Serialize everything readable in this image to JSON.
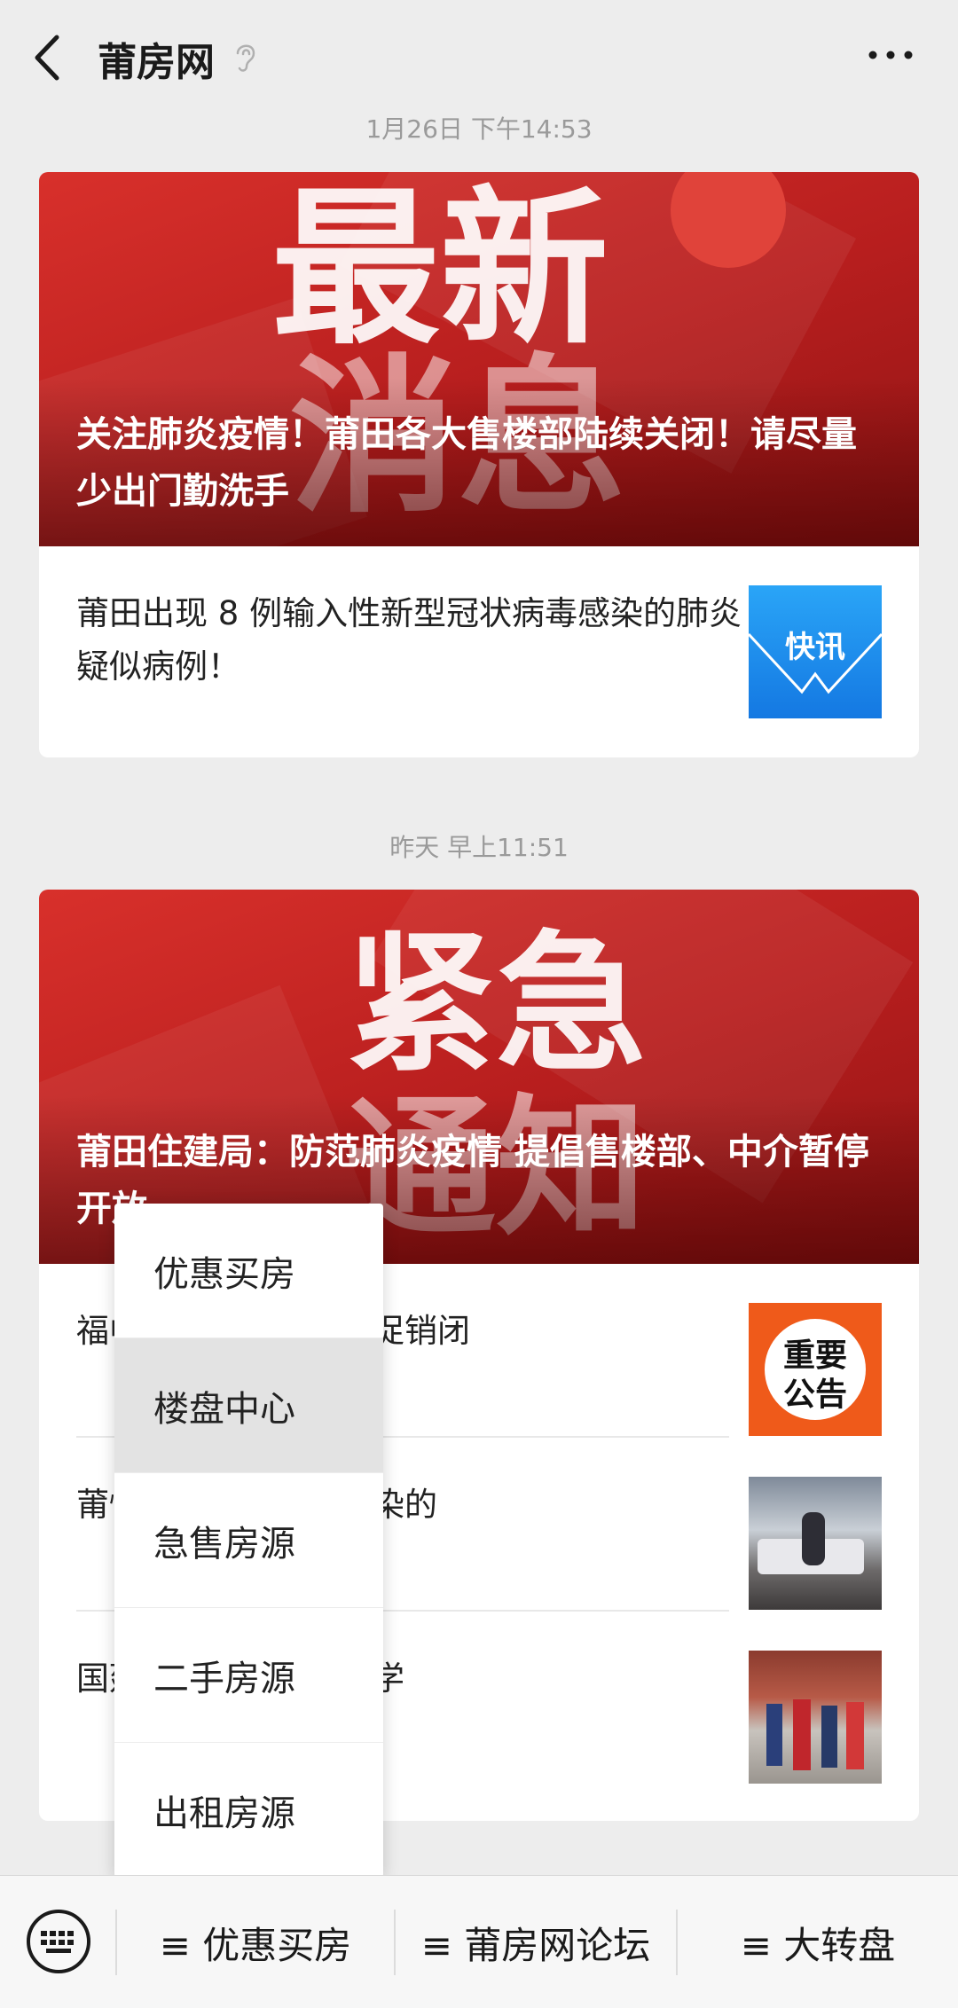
{
  "header": {
    "title": "莆房网"
  },
  "feed": [
    {
      "timestamp": "1月26日 下午14:53",
      "banner_text_1": "最新",
      "banner_text_2": "消息",
      "headline": "关注肺炎疫情！莆田各大售楼部陆续关闭！请尽量少出门勤洗手",
      "items": [
        {
          "text": "莆田出现 8 例输入性新型冠状病毒感染的肺炎疑似病例！",
          "thumb_label": "快讯"
        }
      ]
    },
    {
      "timestamp": "昨天 早上11:51",
      "banner_text_1": "紧急",
      "banner_text_2": "通知",
      "headline": "莆田住建局：防范肺炎疫情 提倡售楼部、中介暂停开放",
      "items": [
        {
          "text": "福中介禁止现场集中促销闭",
          "thumb_label_1": "重要",
          "thumb_label_2": "公告"
        },
        {
          "text": "莆性新型冠状病毒感染的"
        },
        {
          "text": "国延长，学校推迟开学"
        }
      ]
    }
  ],
  "popup_menu": {
    "options": [
      "优惠买房",
      "楼盘中心",
      "急售房源",
      "二手房源",
      "出租房源"
    ],
    "highlighted": "楼盘中心"
  },
  "bottom_bar": {
    "tabs": [
      "≡ 优惠买房",
      "≡ 莆房网论坛",
      "≡ 大转盘"
    ]
  },
  "colors": {
    "banner_red": "#c62a26",
    "thumb_blue": "#1e8ff0",
    "thumb_orange": "#f05a1c"
  }
}
